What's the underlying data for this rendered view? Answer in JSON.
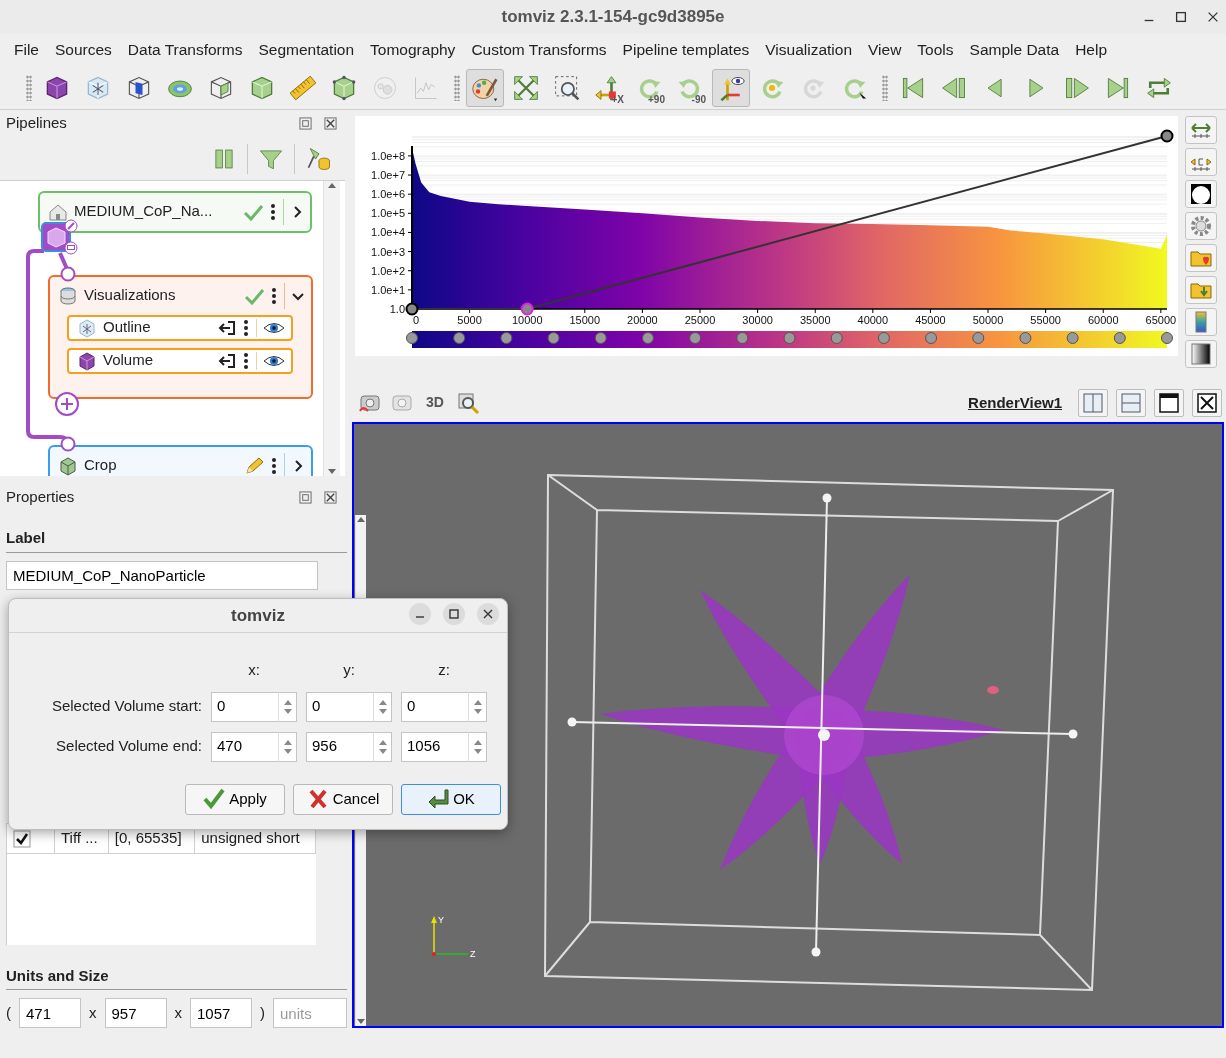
{
  "window": {
    "title": "tomviz 2.3.1-154-gc9d3895e"
  },
  "menu": [
    "File",
    "Sources",
    "Data Transforms",
    "Segmentation",
    "Tomography",
    "Custom Transforms",
    "Pipeline templates",
    "Visualization",
    "View",
    "Tools",
    "Sample Data",
    "Help"
  ],
  "toolbars": [
    [
      {
        "selected": false,
        "disabled": false
      },
      {
        "selected": false,
        "disabled": false
      },
      {
        "selected": false,
        "disabled": false
      },
      {
        "selected": false,
        "disabled": false
      },
      {
        "selected": false,
        "disabled": false
      },
      {
        "selected": false,
        "disabled": false
      },
      {
        "selected": false,
        "disabled": false
      },
      {
        "selected": false,
        "disabled": false
      },
      {
        "selected": false,
        "disabled": true
      },
      {
        "selected": false,
        "disabled": true
      }
    ],
    [
      {
        "selected": true,
        "disabled": false
      },
      {
        "selected": false,
        "disabled": false
      },
      {
        "selected": false,
        "disabled": false
      },
      {
        "selected": false,
        "disabled": false,
        "caption": "+X"
      },
      {
        "selected": false,
        "disabled": false,
        "caption": "+90"
      },
      {
        "selected": false,
        "disabled": false,
        "caption": "-90"
      },
      {
        "selected": true,
        "disabled": false
      },
      {
        "selected": false,
        "disabled": false
      },
      {
        "selected": false,
        "disabled": true
      },
      {
        "selected": false,
        "disabled": false
      }
    ],
    [
      {
        "selected": false,
        "disabled": false
      },
      {
        "selected": false,
        "disabled": false
      },
      {
        "selected": false,
        "disabled": false
      },
      {
        "selected": false,
        "disabled": false
      },
      {
        "selected": false,
        "disabled": false
      },
      {
        "selected": false,
        "disabled": false
      },
      {
        "selected": false,
        "disabled": false
      }
    ]
  ],
  "pipelines": {
    "title": "Pipelines",
    "tree": [
      {
        "kind": "source",
        "label": "MEDIUM_CoP_Na...",
        "editing": false,
        "expanded": false,
        "children": [
          {
            "kind": "modules",
            "label": "Visualizations",
            "editing": false,
            "expanded": true,
            "children": [
              {
                "kind": "module",
                "label": "Outline",
                "visible": true
              },
              {
                "kind": "module",
                "label": "Volume",
                "visible": true
              }
            ]
          },
          {
            "kind": "operator",
            "label": "Crop",
            "editing": true,
            "expanded": false
          }
        ]
      }
    ]
  },
  "properties": {
    "title": "Properties",
    "label_heading": "Label",
    "label_value": "MEDIUM_CoP_NanoParticle",
    "arrays": [
      {
        "checked": true,
        "cells": [
          "Tiff ...",
          "[0, 65535]",
          "unsigned short"
        ]
      }
    ],
    "units_heading": "Units and Size",
    "open": "(",
    "sizes": [
      "471",
      "957",
      "1057"
    ],
    "separators": [
      "x",
      "x"
    ],
    "close": ")",
    "units_placeholder": "units"
  },
  "histogram": {
    "y_labels": [
      "1.0e+8",
      "1.0e+7",
      "1.0e+6",
      "1.0e+5",
      "1.0e+4",
      "1.0e+3",
      "1.0e+2",
      "1.0e+1",
      "1.0"
    ],
    "x_labels": [
      "0",
      "5000",
      "10000",
      "15000",
      "20000",
      "25000",
      "30000",
      "35000",
      "40000",
      "45000",
      "50000",
      "55000",
      "60000",
      "65000"
    ]
  },
  "render_view": {
    "mode": "3D",
    "name": "RenderView1",
    "axes_labels": [
      "Y",
      "Z"
    ]
  },
  "dialog": {
    "title": "tomviz",
    "axes": [
      "x:",
      "y:",
      "z:"
    ],
    "rows": [
      {
        "label": "Selected Volume start:",
        "values": [
          "0",
          "0",
          "0"
        ]
      },
      {
        "label": "Selected Volume end:",
        "values": [
          "470",
          "956",
          "1056"
        ]
      }
    ],
    "buttons": [
      {
        "kind": "apply",
        "label": "Apply",
        "default": false
      },
      {
        "kind": "cancel",
        "label": "Cancel",
        "default": false
      },
      {
        "kind": "ok",
        "label": "OK",
        "default": true
      }
    ]
  }
}
